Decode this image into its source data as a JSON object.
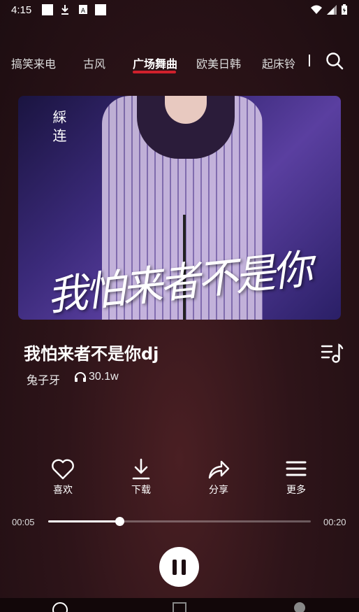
{
  "status_bar": {
    "time": "4:15"
  },
  "tabs": [
    {
      "label": "搞笑来电",
      "active": false
    },
    {
      "label": "古风",
      "active": false
    },
    {
      "label": "广场舞曲",
      "active": true
    },
    {
      "label": "欧美日韩",
      "active": false
    },
    {
      "label": "起床铃",
      "active": false
    }
  ],
  "cover": {
    "title_art": "我怕来者不是你",
    "vertical_text": "綵 连"
  },
  "song": {
    "title": "我怕来者不是你dj",
    "artist": "兔子牙",
    "play_count": "30.1w"
  },
  "actions": [
    {
      "label": "喜欢",
      "icon": "heart-icon"
    },
    {
      "label": "下载",
      "icon": "download-icon"
    },
    {
      "label": "分享",
      "icon": "share-icon"
    },
    {
      "label": "更多",
      "icon": "menu-icon"
    }
  ],
  "player": {
    "current_time": "00:05",
    "total_time": "00:20",
    "progress": 0.27
  },
  "colors": {
    "accent": "#d0202c",
    "background": "#2e1419"
  }
}
